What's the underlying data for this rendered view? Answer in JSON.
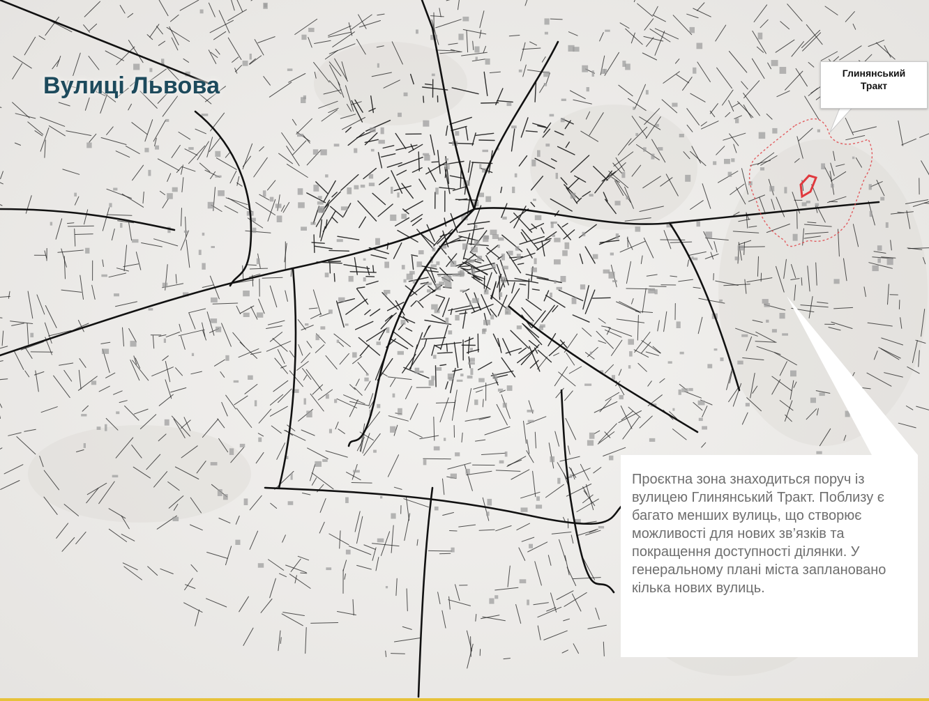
{
  "title": "Вулиці Львова",
  "callout": {
    "line1": "Глинянський",
    "line2": "Тракт"
  },
  "info_text": "Проєктна зона знаходиться поруч із вулицею Глинянський Тракт. Поблизу є багато менших вулиць, що створює можливості для нових зв’язків та покращення доступності ділянки. У генеральному плані міста заплановано кілька нових вулиць.",
  "colors": {
    "title": "#1d4a5c",
    "streets": "#1a1a1a",
    "site_boundary": "#e0393e",
    "accent_line": "#e7c23a"
  }
}
